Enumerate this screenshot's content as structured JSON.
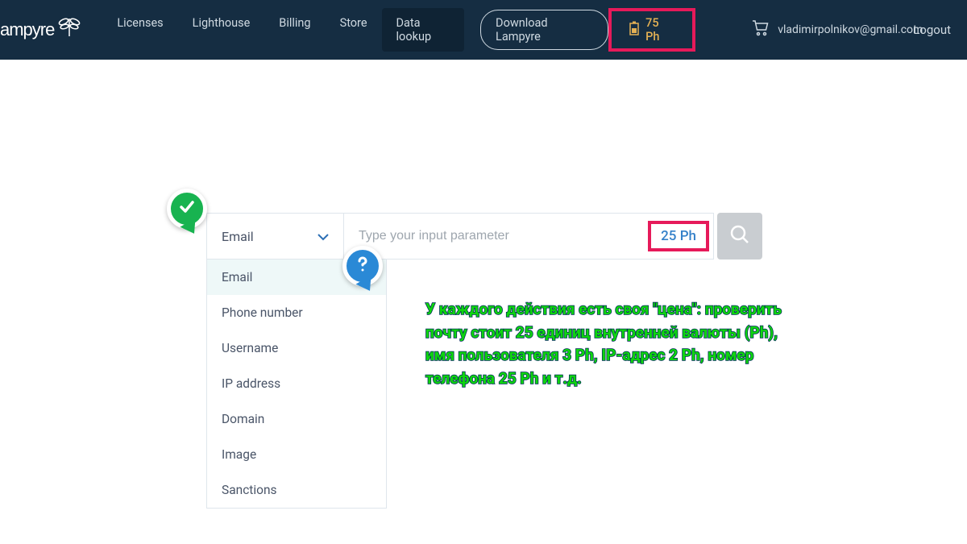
{
  "header": {
    "logo_text": "ampyre",
    "nav": [
      "Licenses",
      "Lighthouse",
      "Billing",
      "Store",
      "Data lookup"
    ],
    "active_nav": "Data lookup",
    "download_label": "Download Lampyre",
    "balance": "75 Ph",
    "user_email": "vladimirpolnikov@gmail.com",
    "logout_label": "Logout"
  },
  "search": {
    "selected_type": "Email",
    "placeholder": "Type your input parameter",
    "cost": "25 Ph",
    "dropdown_options": [
      "Email",
      "Phone number",
      "Username",
      "IP address",
      "Domain",
      "Image",
      "Sanctions"
    ]
  },
  "annotation_text": "У каждого действия есть своя \"цена\": проверить почту стоит 25 единиц внутренней валюты (Ph), имя пользователя 3 Ph, IP-адрес 2 Ph, номер телефона 25 Ph и т.д."
}
